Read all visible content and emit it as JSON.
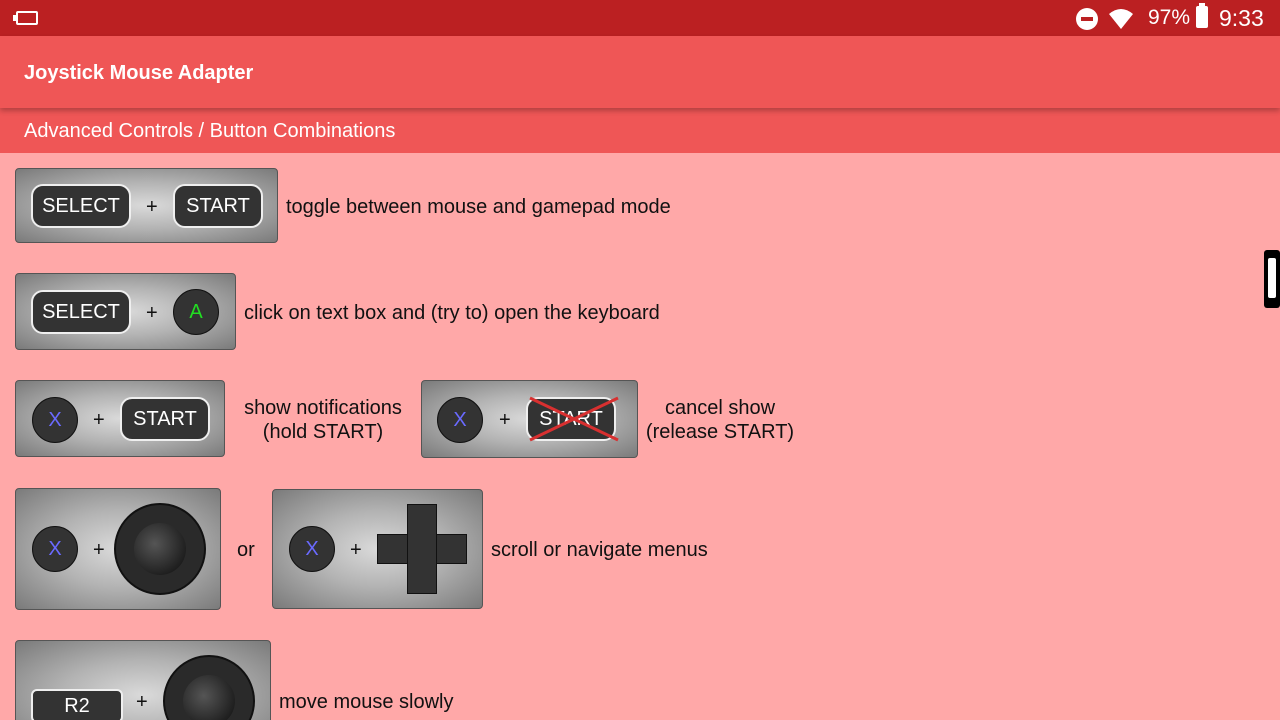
{
  "status_bar": {
    "battery_percent": "97%",
    "time": "9:33",
    "icons": [
      "screen-icon",
      "do-not-disturb-icon",
      "wifi-icon",
      "battery-charging-icon"
    ]
  },
  "app_bar": {
    "title": "Joystick Mouse Adapter"
  },
  "section": {
    "title": "Advanced Controls / Button Combinations"
  },
  "colors": {
    "status_bar": "#bb2022",
    "app_bar": "#ef5656",
    "background": "#ffa8a8",
    "button_a": "#22dd22",
    "button_x": "#6a6aff",
    "cancel_cross": "#d83030"
  },
  "combos": [
    {
      "keys": [
        "SELECT",
        "+",
        "START"
      ],
      "description": "toggle between mouse and gamepad mode"
    },
    {
      "keys": [
        "SELECT",
        "+",
        "A"
      ],
      "description": "click on text box and (try to) open the keyboard"
    },
    {
      "keys": [
        "X",
        "+",
        "START"
      ],
      "description_line1": "show notifications",
      "description_line2": "(hold START)",
      "cancel_keys": [
        "X",
        "+",
        "START"
      ],
      "cancel_line1": "cancel show",
      "cancel_line2": "(release START)"
    },
    {
      "keys": [
        "X",
        "+",
        "left-stick"
      ],
      "separator": "or",
      "alt_keys": [
        "X",
        "+",
        "dpad"
      ],
      "description": "scroll or navigate menus"
    },
    {
      "keys": [
        "R2",
        "+",
        "right-stick"
      ],
      "description": "move mouse slowly"
    }
  ]
}
